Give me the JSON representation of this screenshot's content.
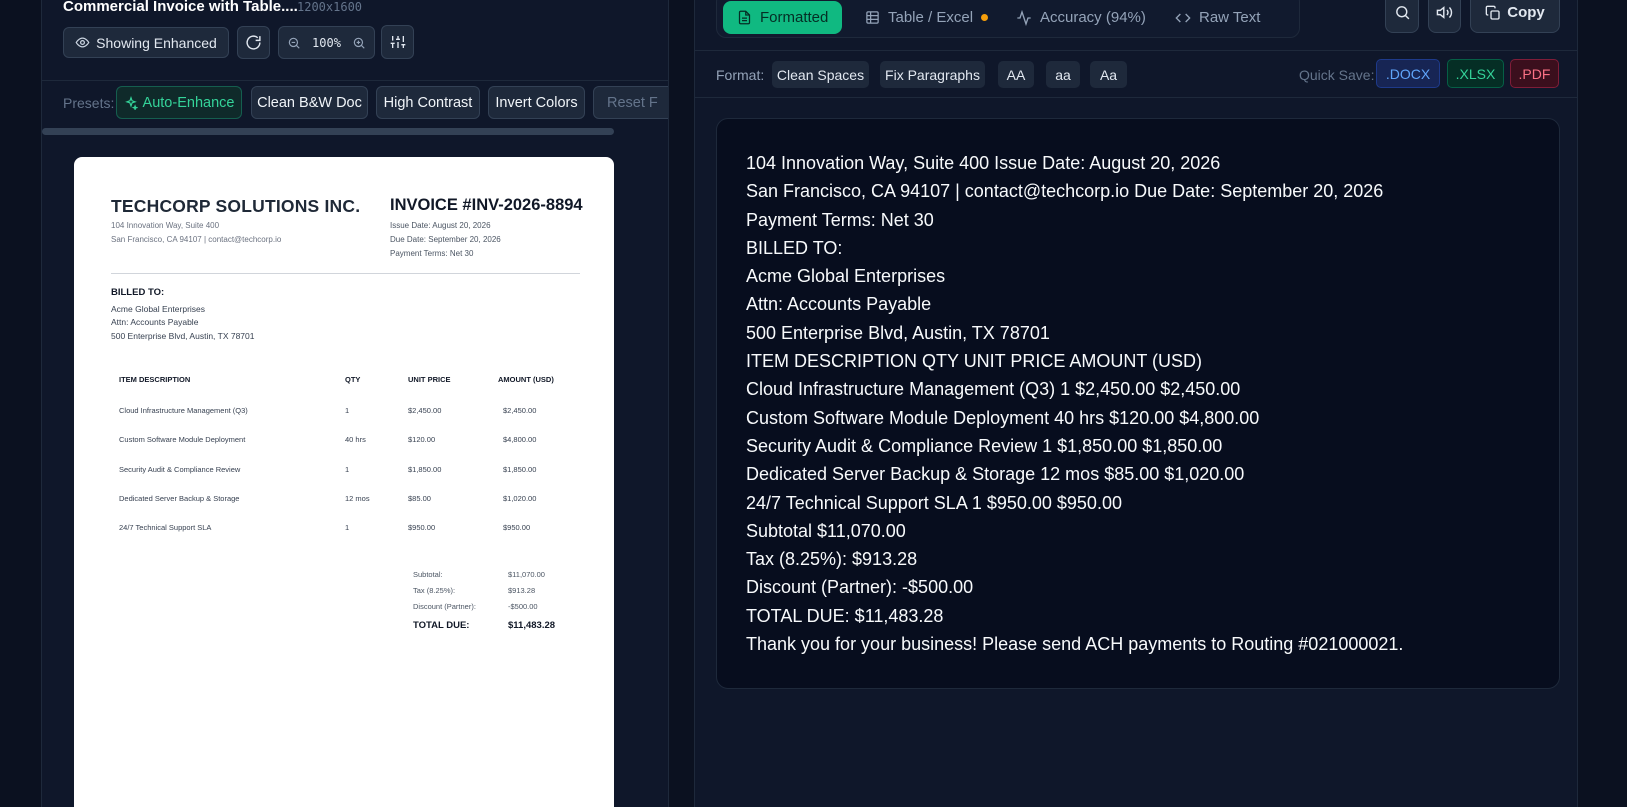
{
  "left": {
    "doc_title": "Commercial Invoice with Table....",
    "doc_dims": "1200x1600",
    "showing_label": "Showing Enhanced",
    "zoom": "100%",
    "presets_label": "Presets:",
    "presets": [
      "Auto-Enhance",
      "Clean B&W Doc",
      "High Contrast",
      "Invert Colors",
      "Reset F"
    ]
  },
  "invoice": {
    "company": "TECHCORP SOLUTIONS INC.",
    "addr1": "104 Innovation Way, Suite 400",
    "addr2": "San Francisco, CA 94107 | contact@techcorp.io",
    "title": "INVOICE #INV-2026-8894",
    "issue": "Issue Date: August 20, 2026",
    "due": "Due Date: September 20, 2026",
    "terms": "Payment Terms: Net 30",
    "billed_heading": "BILLED TO:",
    "billed": [
      "Acme Global Enterprises",
      "Attn: Accounts Payable",
      "500 Enterprise Blvd, Austin, TX 78701"
    ],
    "headers": [
      "ITEM DESCRIPTION",
      "QTY",
      "UNIT PRICE",
      "AMOUNT (USD)"
    ],
    "rows": [
      [
        "Cloud Infrastructure Management (Q3)",
        "1",
        "$2,450.00",
        "$2,450.00"
      ],
      [
        "Custom Software Module Deployment",
        "40 hrs",
        "$120.00",
        "$4,800.00"
      ],
      [
        "Security Audit & Compliance Review",
        "1",
        "$1,850.00",
        "$1,850.00"
      ],
      [
        "Dedicated Server Backup & Storage",
        "12 mos",
        "$85.00",
        "$1,020.00"
      ],
      [
        "24/7 Technical Support SLA",
        "1",
        "$950.00",
        "$950.00"
      ]
    ],
    "totals": [
      [
        "Subtotal:",
        "$11,070.00"
      ],
      [
        "Tax (8.25%):",
        "$913.28"
      ],
      [
        "Discount (Partner):",
        "-$500.00"
      ],
      [
        "TOTAL DUE:",
        "$11,483.28"
      ]
    ]
  },
  "right": {
    "tabs": [
      "Formatted",
      "Table / Excel",
      "Accuracy (94%)",
      "Raw Text"
    ],
    "copy_label": "Copy",
    "format_label": "Format:",
    "format_chips": [
      "Clean Spaces",
      "Fix Paragraphs",
      "AA",
      "aa",
      "Aa"
    ],
    "quick_save_label": "Quick Save:",
    "save_docx": ".DOCX",
    "save_xlsx": ".XLSX",
    "save_pdf": ".PDF",
    "text_lines": [
      "104 Innovation Way, Suite 400 Issue Date: August 20, 2026",
      "San Francisco, CA 94107 | contact@techcorp.io Due Date: September 20, 2026",
      "Payment Terms: Net 30",
      "BILLED TO:",
      "Acme Global Enterprises",
      "Attn: Accounts Payable",
      "500 Enterprise Blvd, Austin, TX 78701",
      "ITEM DESCRIPTION QTY UNIT PRICE AMOUNT (USD)",
      "Cloud Infrastructure Management (Q3) 1 $2,450.00 $2,450.00",
      "Custom Software Module Deployment 40 hrs $120.00 $4,800.00",
      "Security Audit & Compliance Review 1 $1,850.00 $1,850.00",
      "Dedicated Server Backup & Storage 12 mos $85.00 $1,020.00",
      "24/7 Technical Support SLA 1 $950.00 $950.00",
      "Subtotal $11,070.00",
      "Tax (8.25%): $913.28",
      "Discount (Partner): -$500.00",
      "TOTAL DUE: $11,483.28",
      "Thank you for your business! Please send ACH payments to Routing #021000021."
    ]
  }
}
